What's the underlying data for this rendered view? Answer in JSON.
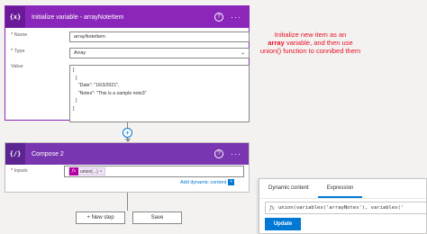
{
  "card1": {
    "icon_text": "{x}",
    "title": "Initialize variable - arrayNoteItem",
    "name_label": "Name",
    "name_value": "arrayNoteItem",
    "type_label": "Type",
    "type_value": "Array",
    "value_label": "Value",
    "value_lines": [
      "[",
      "  {",
      "    \"Date\": \"16/3/2021\",",
      "    \"Notes\": \"This is a sample note3\"",
      "  }",
      "]"
    ],
    "required_mark": "*"
  },
  "card2": {
    "icon_text": "{/}",
    "title": "Compose 2",
    "inputs_label": "Inputs",
    "token_icon": "fx",
    "token_text": "union(...)",
    "token_remove": "×",
    "add_dynamic_label": "Add dynamic content"
  },
  "help_glyph": "?",
  "more_glyph": "···",
  "plus_glyph": "+",
  "buttons": {
    "new_step": "+ New step",
    "save": "Save"
  },
  "annotation": {
    "line1_pre": "Initialize new item as an",
    "bold": "array",
    "line2_post": " variable, and then use union() function to connibed them"
  },
  "expression_panel": {
    "tab_dynamic": "Dynamic content",
    "tab_expression": "Expression",
    "fx": "fx",
    "expression": "union(variables('arrayNotes'), variables('",
    "update": "Update"
  },
  "colors": {
    "variable_header": "#8a27ba",
    "compose_header": "#7a36b1",
    "annotation": "#e81123",
    "accent": "#0078d4"
  }
}
